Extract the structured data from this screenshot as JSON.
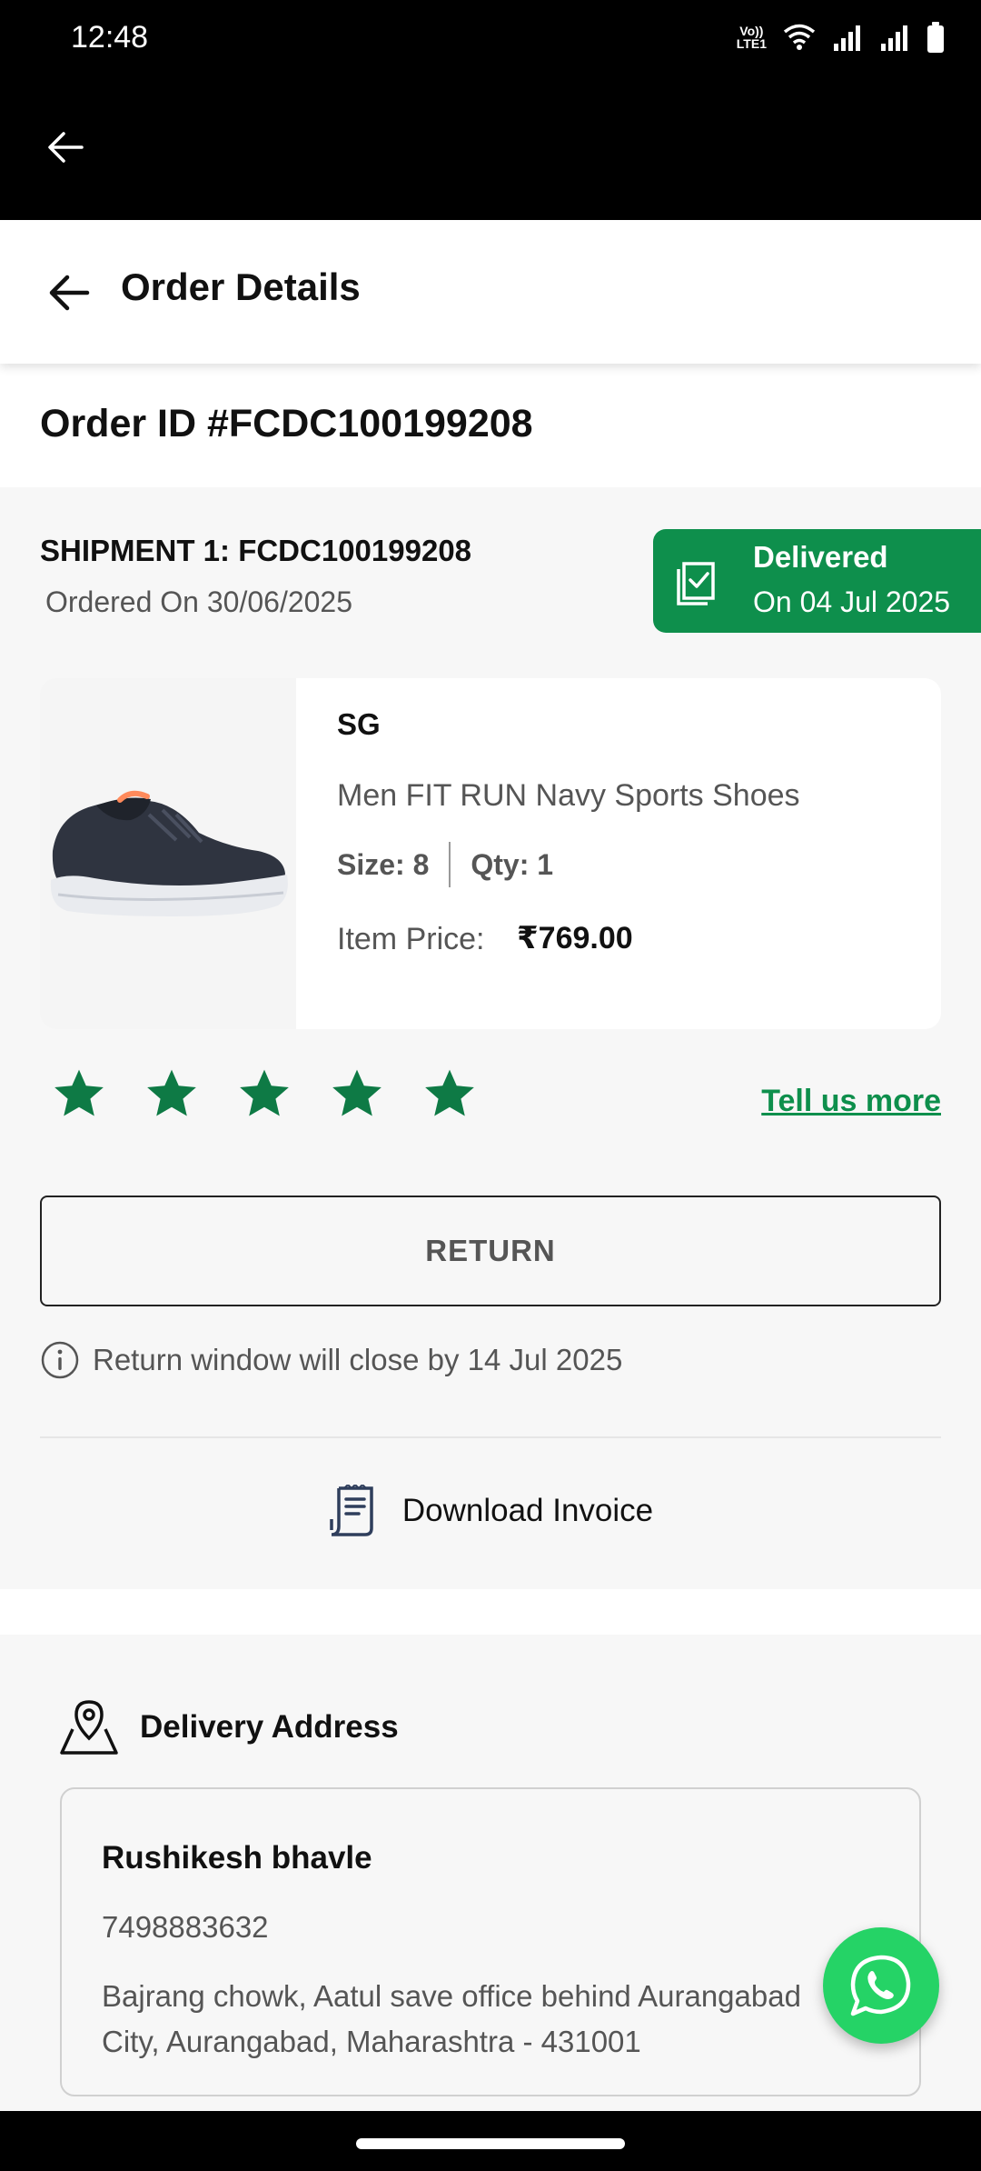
{
  "status_bar": {
    "time": "12:48",
    "volte_line1": "Vo))",
    "volte_line2": "LTE1",
    "icons": [
      "volte-icon",
      "wifi-icon",
      "signal-icon",
      "signal-icon",
      "battery-icon"
    ]
  },
  "header": {
    "title": "Order Details"
  },
  "order": {
    "order_id": "Order ID #FCDC100199208"
  },
  "shipment": {
    "title": "SHIPMENT 1: FCDC100199208",
    "ordered_on": "Ordered On 30/06/2025",
    "status": "Delivered",
    "status_date": "On 04 Jul 2025"
  },
  "product": {
    "brand": "SG",
    "name": "Men FIT RUN Navy Sports Shoes",
    "size": "Size: 8",
    "qty": "Qty: 1",
    "price_label": "Item Price:",
    "price": "₹769.00"
  },
  "rating": {
    "stars": 5,
    "max": 5,
    "tell_more": "Tell us more"
  },
  "actions": {
    "return_label": "RETURN",
    "return_info": "Return window will close by 14 Jul 2025",
    "download_invoice": "Download Invoice"
  },
  "address": {
    "title": "Delivery Address",
    "name": "Rushikesh bhavle",
    "phone": "7498883632",
    "line": "Bajrang chowk, Aatul save office behind Aurangabad City, Aurangabad, Maharashtra - 431001"
  },
  "colors": {
    "accent_green": "#0e8f4c",
    "whatsapp_green": "#25d366",
    "star_green": "#0e7a45"
  }
}
